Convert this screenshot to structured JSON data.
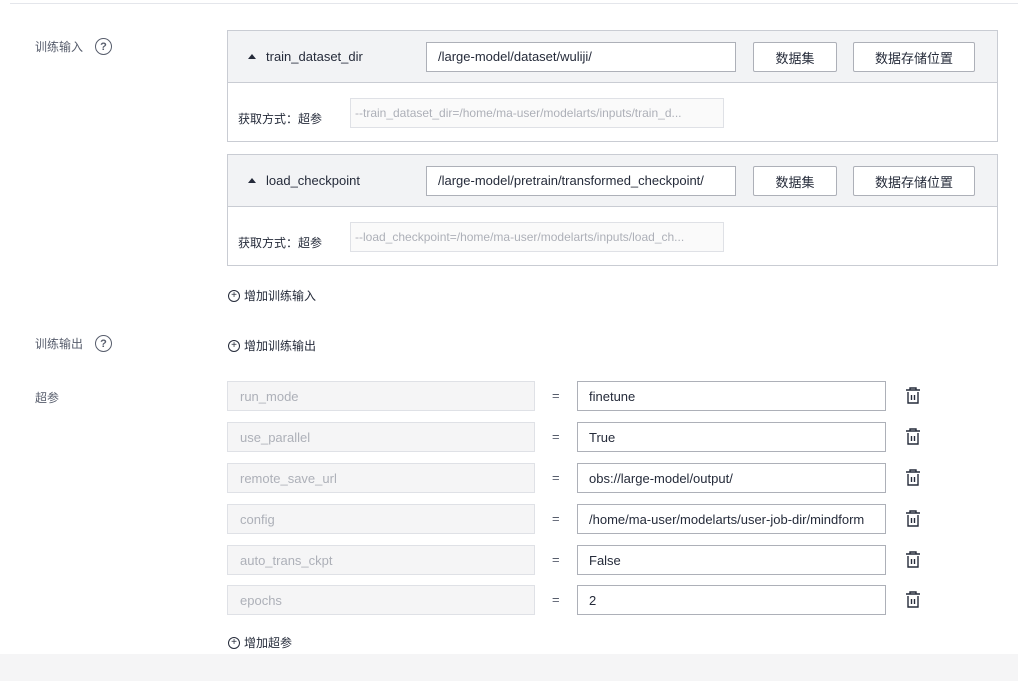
{
  "training_input": {
    "label": "训练输入",
    "help_icon": "question-circle-icon",
    "items": [
      {
        "name": "train_dataset_dir",
        "path": "/large-model/dataset/wuliji/",
        "dataset_button": "数据集",
        "storage_button": "数据存储位置",
        "acquire_label": "获取方式：超参",
        "acquire_value": "--train_dataset_dir=/home/ma-user/modelarts/inputs/train_d..."
      },
      {
        "name": "load_checkpoint",
        "path": "/large-model/pretrain/transformed_checkpoint/",
        "dataset_button": "数据集",
        "storage_button": "数据存储位置",
        "acquire_label": "获取方式：超参",
        "acquire_value": "--load_checkpoint=/home/ma-user/modelarts/inputs/load_ch..."
      }
    ],
    "add_label": "增加训练输入"
  },
  "training_output": {
    "label": "训练输出",
    "help_icon": "question-circle-icon",
    "add_label": "增加训练输出"
  },
  "hyperparams": {
    "label": "超参",
    "equals": "=",
    "items": [
      {
        "key": "run_mode",
        "value": "finetune"
      },
      {
        "key": "use_parallel",
        "value": "True"
      },
      {
        "key": "remote_save_url",
        "value": "obs://large-model/output/"
      },
      {
        "key": "config",
        "value": "/home/ma-user/modelarts/user-job-dir/mindform"
      },
      {
        "key": "auto_trans_ckpt",
        "value": "False"
      },
      {
        "key": "epochs",
        "value": "2"
      }
    ],
    "add_label": "增加超参"
  },
  "colors": {
    "card_header": "#f2f3f5",
    "border": "#c9ccd3",
    "text": "#252b3a",
    "muted": "#adb0b8"
  }
}
